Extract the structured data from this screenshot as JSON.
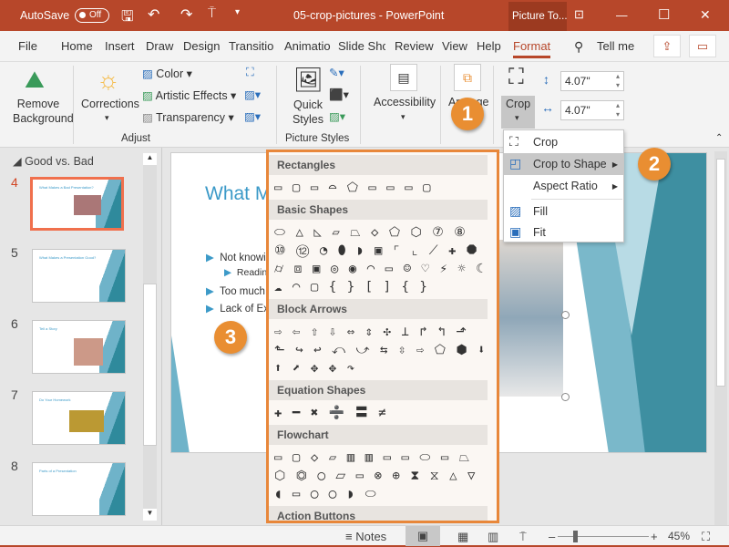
{
  "titlebar": {
    "autosave": "AutoSave",
    "toggle": "Off",
    "title": "05-crop-pictures  -  PowerPoint",
    "picture_tools": "Picture To...",
    "minimize": "—",
    "restore": "☐",
    "close": "✕"
  },
  "tabs": [
    "File",
    "Home",
    "Insert",
    "Draw",
    "Design",
    "Transitio",
    "Animatio",
    "Slide Sho",
    "Review",
    "View",
    "Help",
    "Format"
  ],
  "active_tab": "Format",
  "tell_me": "Tell me",
  "ribbon": {
    "remove_background": "Remove Background",
    "corrections": "Corrections",
    "color": "Color",
    "artistic_effects": "Artistic Effects",
    "transparency": "Transparency",
    "adjust_group": "Adjust",
    "quick_styles": "Quick Styles",
    "picture_styles_group": "Picture Styles",
    "accessibility": "Accessibility",
    "arrange": "Arrange",
    "crop": "Crop",
    "height": "4.07\"",
    "width": "4.07\""
  },
  "left_pane": {
    "section": "Good vs. Bad",
    "slides": [
      {
        "num": "4",
        "title": "What Makes a Bad Presentation?",
        "selected": true
      },
      {
        "num": "5",
        "title": "What Makes a Presentation Good?"
      },
      {
        "num": "6",
        "title": "Tell a Story"
      },
      {
        "num": "7",
        "title": "Do Your Homework"
      },
      {
        "num": "8",
        "title": "Parts of a Presentation"
      }
    ]
  },
  "slide": {
    "title": "What M",
    "bullets": [
      "Not knowin",
      "Readin",
      "Too much i",
      "Lack of Ex"
    ]
  },
  "crop_menu": [
    {
      "label": "Crop",
      "icon": "crop-icon"
    },
    {
      "label": "Crop to Shape",
      "icon": "crop-to-shape-icon",
      "submenu": true,
      "highlighted": true
    },
    {
      "label": "Aspect Ratio",
      "submenu": true
    },
    {
      "label": "Fill",
      "icon": "fill-icon"
    },
    {
      "label": "Fit",
      "icon": "fit-icon"
    }
  ],
  "gallery": [
    {
      "header": "Rectangles",
      "shapes": "▭▢▭⌓⬠▭▭▭▢"
    },
    {
      "header": "Basic Shapes",
      "shapes": "⬭△◺▱⏢◇⬠⬡⑦⑧⑩⑫◔⬮◗▣⌜⌞⟋✚⯃⌭⧈▣◎◉◠▭☺♡⚡☼☾☁◠▢{}[]{}"
    },
    {
      "header": "Block Arrows",
      "shapes": "⇨⇦⇧⇩⇔⇕✣⊥↱↰⬏⬑↪↩⤺⤻⇆⇳⇨⬠⬢⬇⬆⬈✥✥↷"
    },
    {
      "header": "Equation Shapes",
      "shapes": "✚━✖➗〓≠"
    },
    {
      "header": "Flowchart",
      "shapes": "▭▢◇▱▥▥▭▭⬭▭⏢⬡⏣◯⏥▭⊗⊕⧗⧖△▽◖▭◯◯◗⬭"
    },
    {
      "header": "Action Buttons",
      "shapes": "◁▷⏮⏭⌂ⓘ↩▶▯🔊?▭"
    }
  ],
  "callouts": [
    "1",
    "2",
    "3"
  ],
  "status": {
    "notes": "Notes",
    "zoom": "45%",
    "zoom_level": 45
  },
  "colors": {
    "accent": "#b7472a",
    "callout": "#e98e32",
    "slide_title": "#3c9ac8"
  }
}
